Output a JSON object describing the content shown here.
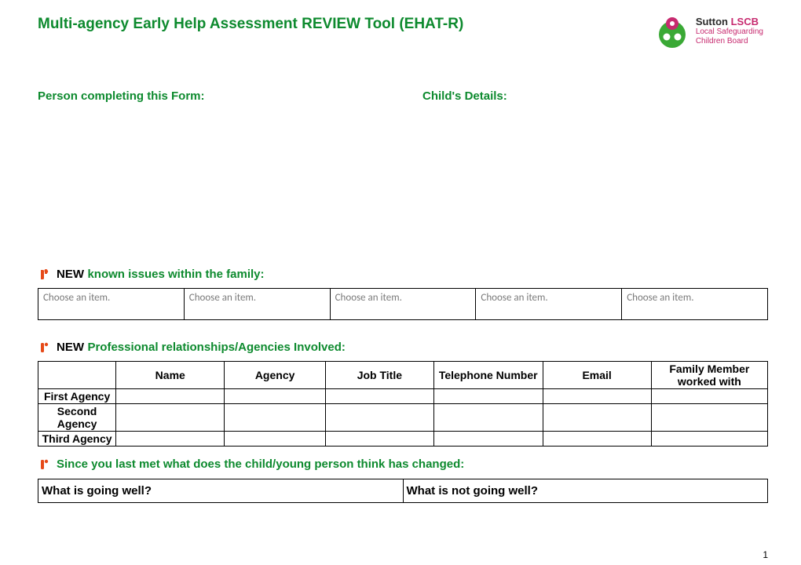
{
  "title": "Multi-agency Early Help Assessment REVIEW Tool (EHAT-R)",
  "logo": {
    "brand_dark": "Sutton",
    "brand_pink": "LSCB",
    "sub1": "Local Safeguarding",
    "sub2": "Children Board"
  },
  "labels": {
    "person_completing": "Person completing this Form:",
    "child_details": "Child's Details:"
  },
  "section_new_issues": {
    "prefix": "NEW",
    "heading": "known issues within the family:",
    "placeholder": "Choose an item."
  },
  "section_agencies": {
    "prefix": "NEW",
    "heading": "Professional relationships/Agencies Involved:",
    "headers": {
      "name": "Name",
      "agency": "Agency",
      "job_title": "Job Title",
      "telephone": "Telephone Number",
      "email": "Email",
      "family_member": "Family Member worked with"
    },
    "rows": [
      "First Agency",
      "Second Agency",
      "Third Agency"
    ]
  },
  "section_changed": {
    "heading": "Since you last met what does the child/young person think has changed:",
    "col_left": "What is going well?",
    "col_right": "What is not going well?"
  },
  "page_number": "1"
}
